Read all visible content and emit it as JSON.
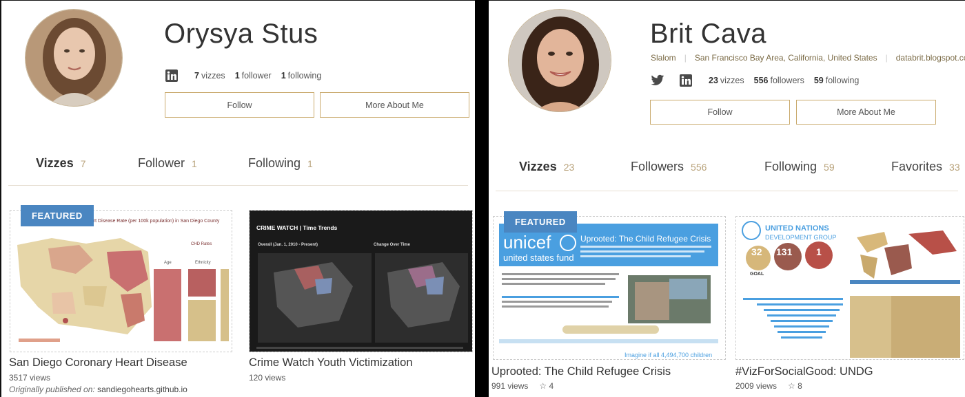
{
  "left": {
    "name": "Orysya Stus",
    "stats": {
      "vizzes_count": "7",
      "vizzes_label": "vizzes",
      "followers_count": "1",
      "followers_label": "follower",
      "following_count": "1",
      "following_label": "following"
    },
    "buttons": {
      "follow": "Follow",
      "more": "More About Me"
    },
    "tabs": [
      {
        "label": "Vizzes",
        "count": "7"
      },
      {
        "label": "Follower",
        "count": "1"
      },
      {
        "label": "Following",
        "count": "1"
      }
    ],
    "cards": [
      {
        "title": "San Diego Coronary Heart Disease",
        "views": "3517 views",
        "published_prefix": "Originally published on:",
        "published_site": "sandiegohearts.github.io",
        "featured": "FEATURED",
        "thumb_title": "Heart Disease Rate (per 100k population) in San Diego County",
        "legend_title": "CHD Rates",
        "cols": [
          "Age",
          "Ethnicity"
        ]
      },
      {
        "title": "Crime Watch Youth Victimization",
        "views": "120 views",
        "thumb_title": "CRIME WATCH | Time Trends",
        "sub_left": "Overall (Jan. 1, 2010 - Present)",
        "sub_right": "Change Over Time"
      }
    ]
  },
  "right": {
    "name": "Brit Cava",
    "meta": {
      "org": "Slalom",
      "location": "San Francisco Bay Area, California, United States",
      "site": "databrit.blogspot.com"
    },
    "stats": {
      "vizzes_count": "23",
      "vizzes_label": "vizzes",
      "followers_count": "556",
      "followers_label": "followers",
      "following_count": "59",
      "following_label": "following"
    },
    "buttons": {
      "follow": "Follow",
      "more": "More About Me"
    },
    "tabs": [
      {
        "label": "Vizzes",
        "count": "23"
      },
      {
        "label": "Followers",
        "count": "556"
      },
      {
        "label": "Following",
        "count": "59"
      },
      {
        "label": "Favorites",
        "count": "33"
      }
    ],
    "cards": [
      {
        "title": "Uprooted: The Child Refugee Crisis",
        "views": "991 views",
        "stars": "4",
        "featured": "FEATURED",
        "brand": "unicef",
        "brand_sub": "united states fund",
        "thumb_title": "Uprooted: The Child Refugee Crisis",
        "footer": "Imagine if all 4,494,700 children"
      },
      {
        "title": "#VizForSocialGood: UNDG",
        "views": "2009 views",
        "stars": "8",
        "brand": "UNITED NATIONS",
        "brand_sub": "DEVELOPMENT GROUP",
        "bubbles": [
          "32",
          "131",
          "1"
        ],
        "goal": "GOAL"
      }
    ]
  },
  "colors": {
    "accent": "#c9a96c",
    "featured": "#4a86c1",
    "muted": "#b8a27a"
  }
}
